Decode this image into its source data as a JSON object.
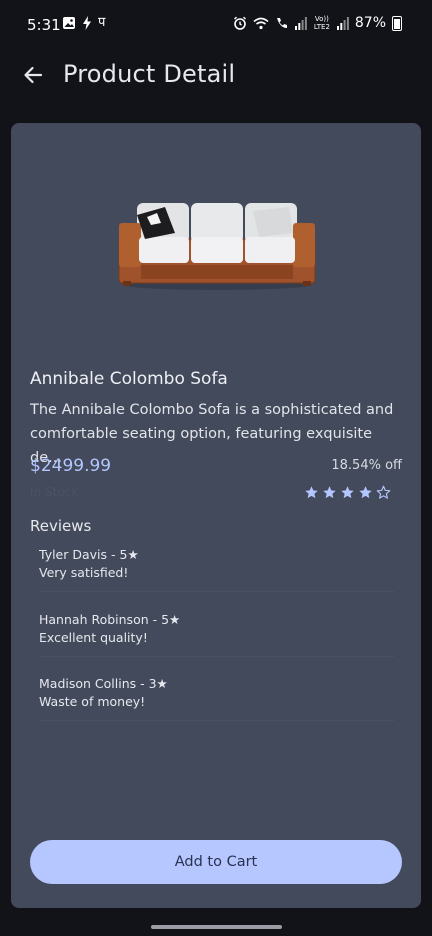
{
  "status_bar": {
    "time": "5:31",
    "battery": "87%",
    "left_icons": [
      "gallery-icon",
      "bolt-icon",
      "pe-icon"
    ],
    "right_icons": [
      "alarm-icon",
      "wifi-icon",
      "wifi-call-icon",
      "signal-icon",
      "volte-icon",
      "signal-icon-2",
      "battery-icon"
    ],
    "lte_label": "Vo)) LTE2"
  },
  "app_bar": {
    "title": "Product Detail",
    "back_icon": "arrow-left-icon"
  },
  "product": {
    "name": "Annibale Colombo Sofa",
    "description": "The Annibale Colombo Sofa is a sophisticated and comfortable seating option, featuring exquisite de...",
    "price": "$2499.99",
    "discount": "18.54% off",
    "stock": "In Stock",
    "rating_stars": 4,
    "max_stars": 5
  },
  "reviews": {
    "title": "Reviews",
    "items": [
      {
        "header": "Tyler Davis - 5★",
        "comment": "Very satisfied!"
      },
      {
        "header": "Hannah Robinson - 5★",
        "comment": "Excellent quality!"
      },
      {
        "header": "Madison Collins - 3★",
        "comment": "Waste of money!"
      }
    ]
  },
  "actions": {
    "add_to_cart": "Add to Cart"
  },
  "colors": {
    "background": "#111318",
    "card": "#434a5b",
    "accent": "#b6c6ff",
    "price": "#b4c6ff",
    "star": "#b4c6ff"
  }
}
